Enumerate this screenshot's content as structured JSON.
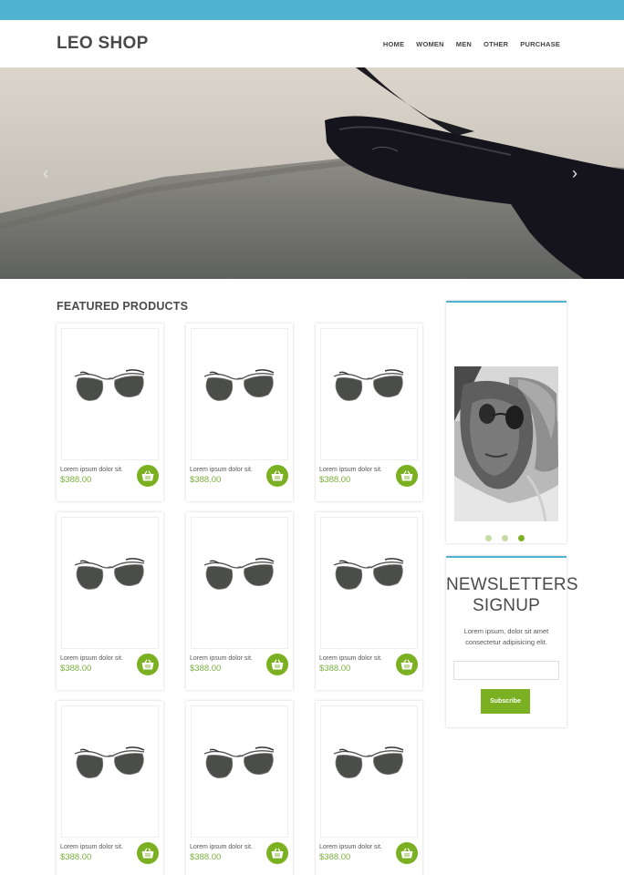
{
  "header": {
    "logo": "LEO SHOP",
    "nav": [
      "HOME",
      "WOMEN",
      "MEN",
      "OTHER",
      "PURCHASE"
    ]
  },
  "hero": {
    "prev_icon": "chevron-left-icon",
    "next_icon": "chevron-right-icon",
    "prev_glyph": "‹",
    "next_glyph": "›"
  },
  "featured": {
    "title": "FEATURED PRODUCTS",
    "products": [
      {
        "name": "Lorem ipsum dolor sit.",
        "price": "$388.00"
      },
      {
        "name": "Lorem ipsum dolor sit.",
        "price": "$388.00"
      },
      {
        "name": "Lorem ipsum dolor sit.",
        "price": "$388.00"
      },
      {
        "name": "Lorem ipsum dolor sit.",
        "price": "$388.00"
      },
      {
        "name": "Lorem ipsum dolor sit.",
        "price": "$388.00"
      },
      {
        "name": "Lorem ipsum dolor sit.",
        "price": "$388.00"
      },
      {
        "name": "Lorem ipsum dolor sit.",
        "price": "$388.00"
      },
      {
        "name": "Lorem ipsum dolor sit.",
        "price": "$388.00"
      },
      {
        "name": "Lorem ipsum dolor sit.",
        "price": "$388.00"
      }
    ],
    "cart_icon": "basket-icon"
  },
  "sidebar": {
    "slider_dots": 3,
    "active_dot": 3
  },
  "newsletter": {
    "title_line1": "NEWSLETTERS",
    "title_line2": "SIGNUP",
    "text": "Lorem ipsum, dolor sit amet consectetur adipisicing elit.",
    "input_placeholder": "",
    "button": "Subscribe"
  },
  "colors": {
    "topbar": "#4fb3cf",
    "accent_green": "#7ab021",
    "price_green": "#7ab03c"
  }
}
